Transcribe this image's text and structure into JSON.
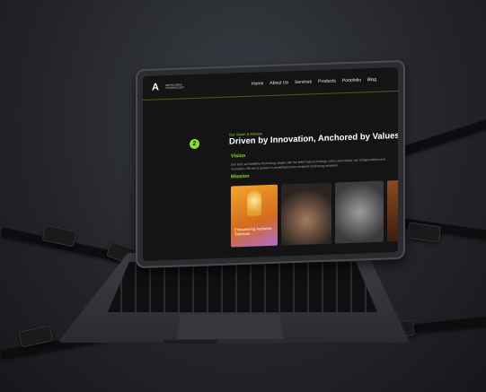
{
  "nav": {
    "logo_text": "ARTHA LEKA TECHNOLOGY",
    "items": [
      "Home",
      "About Us",
      "Services",
      "Products",
      "Portofolio",
      "Blog"
    ]
  },
  "section": {
    "step_number": "2",
    "eyebrow": "Our Vision & Mission",
    "headline": "Driven by Innovation, Anchored by Values",
    "vision_label": "Vision",
    "vision_text": "Our story at Arthaleka Technology began with the belief that technology, when used wisely, can bridge tradition and innovation. We are a pioneer in providing human-centered technology solutions.",
    "mission_label": "Mission",
    "card_caption": "Empowering Authentic Solutions"
  },
  "colors": {
    "accent": "#8ddc2e",
    "screen_bg": "#141414"
  }
}
